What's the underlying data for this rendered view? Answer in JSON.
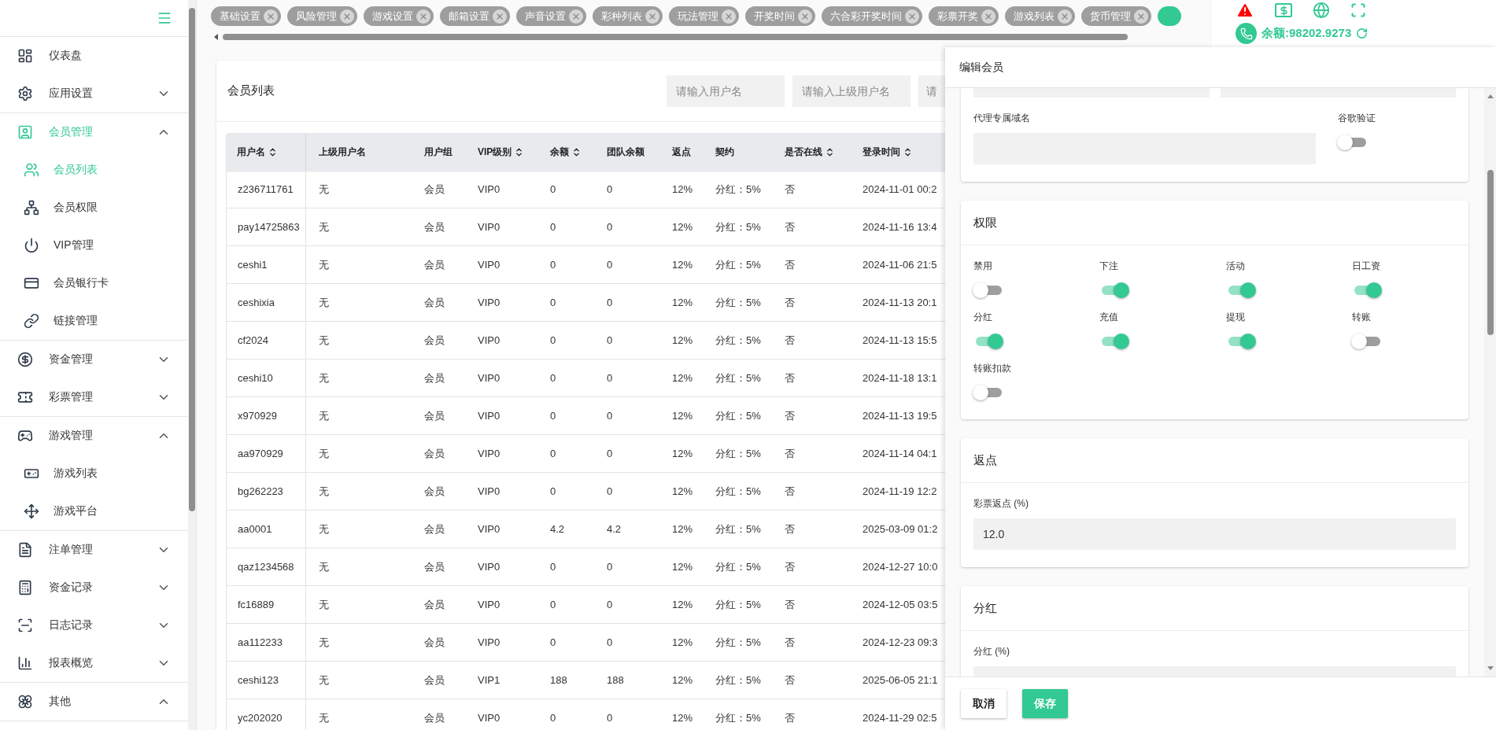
{
  "sidebar": {
    "items": [
      {
        "label": "仪表盘",
        "selected": false
      },
      {
        "label": "应用设置",
        "selected": false,
        "expanded": false
      },
      {
        "label": "会员管理",
        "selected": true,
        "expanded": true,
        "children": [
          {
            "label": "会员列表",
            "selected": true
          },
          {
            "label": "会员权限",
            "selected": false
          },
          {
            "label": "VIP管理",
            "selected": false
          },
          {
            "label": "会员银行卡",
            "selected": false
          },
          {
            "label": "链接管理",
            "selected": false
          }
        ]
      },
      {
        "label": "资金管理",
        "selected": false,
        "expanded": false
      },
      {
        "label": "彩票管理",
        "selected": false,
        "expanded": false
      },
      {
        "label": "游戏管理",
        "selected": false,
        "expanded": true,
        "children": [
          {
            "label": "游戏列表",
            "selected": false
          },
          {
            "label": "游戏平台",
            "selected": false
          }
        ]
      },
      {
        "label": "注单管理",
        "selected": false,
        "expanded": false
      },
      {
        "label": "资金记录",
        "selected": false,
        "expanded": false
      },
      {
        "label": "日志记录",
        "selected": false,
        "expanded": false
      },
      {
        "label": "报表概览",
        "selected": false,
        "expanded": false
      },
      {
        "label": "其他",
        "selected": false,
        "expanded": true
      }
    ]
  },
  "tabs": [
    {
      "label": "基础设置",
      "selected": false
    },
    {
      "label": "风险管理",
      "selected": false
    },
    {
      "label": "游戏设置",
      "selected": false
    },
    {
      "label": "邮箱设置",
      "selected": false
    },
    {
      "label": "声音设置",
      "selected": false
    },
    {
      "label": "彩种列表",
      "selected": false
    },
    {
      "label": "玩法管理",
      "selected": false
    },
    {
      "label": "开奖时间",
      "selected": false
    },
    {
      "label": "六合彩开奖时间",
      "selected": false
    },
    {
      "label": "彩票开奖",
      "selected": false
    },
    {
      "label": "游戏列表",
      "selected": false
    },
    {
      "label": "货币管理",
      "selected": false
    },
    {
      "selected": true
    }
  ],
  "header": {
    "balance": "余额:98202.9273"
  },
  "member_list": {
    "title": "会员列表",
    "filters": [
      {
        "placeholder": "请输入用户名"
      },
      {
        "placeholder": "请输入上级用户名"
      },
      {
        "placeholder": "请"
      }
    ],
    "table": {
      "columns": [
        {
          "label": "用户名",
          "sortable": true
        },
        {
          "label": "上级用户名",
          "sortable": false
        },
        {
          "label": "用户组",
          "sortable": false
        },
        {
          "label": "VIP级别",
          "sortable": true
        },
        {
          "label": "余额",
          "sortable": true
        },
        {
          "label": "团队余额",
          "sortable": false
        },
        {
          "label": "返点",
          "sortable": false
        },
        {
          "label": "契约",
          "sortable": false
        },
        {
          "label": "是否在线",
          "sortable": true
        },
        {
          "label": "登录时间",
          "sortable": true
        }
      ],
      "rows": [
        [
          "z236711761",
          "无",
          "会员",
          "VIP0",
          "0",
          "0",
          "12%",
          "分红：5%",
          "否",
          "2024-11-01 00:2"
        ],
        [
          "pay14725863",
          "无",
          "会员",
          "VIP0",
          "0",
          "0",
          "12%",
          "分红：5%",
          "否",
          "2024-11-16 13:4"
        ],
        [
          "ceshi1",
          "无",
          "会员",
          "VIP0",
          "0",
          "0",
          "12%",
          "分红：5%",
          "否",
          "2024-11-06 21:5"
        ],
        [
          "ceshixia",
          "无",
          "会员",
          "VIP0",
          "0",
          "0",
          "12%",
          "分红：5%",
          "否",
          "2024-11-13 20:1"
        ],
        [
          "cf2024",
          "无",
          "会员",
          "VIP0",
          "0",
          "0",
          "12%",
          "分红：5%",
          "否",
          "2024-11-13 15:5"
        ],
        [
          "ceshi10",
          "无",
          "会员",
          "VIP0",
          "0",
          "0",
          "12%",
          "分红：5%",
          "否",
          "2024-11-18 13:1"
        ],
        [
          "x970929",
          "无",
          "会员",
          "VIP0",
          "0",
          "0",
          "12%",
          "分红：5%",
          "否",
          "2024-11-13 19:5"
        ],
        [
          "aa970929",
          "无",
          "会员",
          "VIP0",
          "0",
          "0",
          "12%",
          "分红：5%",
          "否",
          "2024-11-14 04:1"
        ],
        [
          "bg262223",
          "无",
          "会员",
          "VIP0",
          "0",
          "0",
          "12%",
          "分红：5%",
          "否",
          "2024-11-19 12:2"
        ],
        [
          "aa0001",
          "无",
          "会员",
          "VIP0",
          "4.2",
          "4.2",
          "12%",
          "分红：5%",
          "否",
          "2025-03-09 01:2"
        ],
        [
          "qaz1234568",
          "无",
          "会员",
          "VIP0",
          "0",
          "0",
          "12%",
          "分红：5%",
          "否",
          "2024-12-27 10:0"
        ],
        [
          "fc16889",
          "无",
          "会员",
          "VIP0",
          "0",
          "0",
          "12%",
          "分红：5%",
          "否",
          "2024-12-05 03:5"
        ],
        [
          "aa112233",
          "无",
          "会员",
          "VIP0",
          "0",
          "0",
          "12%",
          "分红：5%",
          "否",
          "2024-12-23 09:3"
        ],
        [
          "ceshi123",
          "无",
          "会员",
          "VIP1",
          "188",
          "188",
          "12%",
          "分红：5%",
          "否",
          "2025-06-05 21:1"
        ],
        [
          "yc202020",
          "无",
          "会员",
          "VIP0",
          "0",
          "0",
          "12%",
          "分红：5%",
          "否",
          "2024-11-29 02:5"
        ]
      ]
    }
  },
  "drawer": {
    "title": "编辑会员",
    "sections": [
      {
        "kind": "partial",
        "fields": [
          {
            "kind": "text",
            "label": "代理专属域名"
          },
          {
            "kind": "toggle",
            "label": "谷歌验证",
            "on": false
          }
        ]
      },
      {
        "kind": "card",
        "title": "权限",
        "fields": [
          {
            "kind": "toggle",
            "label": "禁用",
            "on": false
          },
          {
            "kind": "toggle",
            "label": "下注",
            "on": true
          },
          {
            "kind": "toggle",
            "label": "活动",
            "on": true
          },
          {
            "kind": "toggle",
            "label": "日工资",
            "on": true
          },
          {
            "kind": "toggle",
            "label": "分红",
            "on": true
          },
          {
            "kind": "toggle",
            "label": "充值",
            "on": true
          },
          {
            "kind": "toggle",
            "label": "提现",
            "on": true
          },
          {
            "kind": "toggle",
            "label": "转账",
            "on": false
          },
          {
            "kind": "toggle",
            "label": "转账扣款",
            "on": false
          }
        ]
      },
      {
        "kind": "card",
        "title": "返点",
        "fields": [
          {
            "kind": "text",
            "label": "彩票返点 (%)",
            "value": "12.0"
          }
        ]
      },
      {
        "kind": "card",
        "title": "分红",
        "fields": [
          {
            "kind": "text",
            "label": "分红 (%)"
          }
        ]
      }
    ],
    "buttons": [
      {
        "label": "取消",
        "kind": "default"
      },
      {
        "label": "保存",
        "kind": "primary"
      }
    ]
  }
}
